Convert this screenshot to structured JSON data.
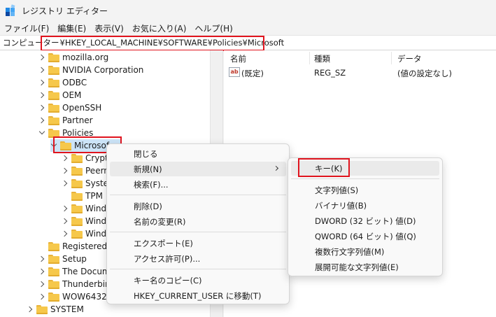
{
  "window": {
    "title": "レジストリ エディター",
    "app_icon": "registry-icon"
  },
  "menubar": {
    "items": [
      "ファイル(F)",
      "編集(E)",
      "表示(V)",
      "お気に入り(A)",
      "ヘルプ(H)"
    ]
  },
  "address": {
    "label": "コンピューター",
    "path": "¥HKEY_LOCAL_MACHINE¥SOFTWARE¥Policies¥Microsoft"
  },
  "tree": {
    "items": [
      {
        "label": "mozilla.org"
      },
      {
        "label": "NVIDIA Corporation"
      },
      {
        "label": "ODBC"
      },
      {
        "label": "OEM"
      },
      {
        "label": "OpenSSH"
      },
      {
        "label": "Partner"
      },
      {
        "label": "Policies"
      },
      {
        "label": "Microsof"
      },
      {
        "label": "Crypt"
      },
      {
        "label": "Peern"
      },
      {
        "label": "Syster"
      },
      {
        "label": "TPM"
      },
      {
        "label": "Windo"
      },
      {
        "label": "Windo"
      },
      {
        "label": "Windo"
      },
      {
        "label": "RegisteredA"
      },
      {
        "label": "Setup"
      },
      {
        "label": "The Docum"
      },
      {
        "label": "Thunderbir"
      },
      {
        "label": "WOW6432N"
      },
      {
        "label": "SYSTEM"
      }
    ]
  },
  "list": {
    "columns": [
      "名前",
      "種類",
      "データ"
    ],
    "rows": [
      {
        "name": "(既定)",
        "type": "REG_SZ",
        "data": "(値の設定なし)",
        "icon": "ab-string-icon"
      }
    ]
  },
  "context_menu": {
    "items": [
      "閉じる",
      "新規(N)",
      "検索(F)...",
      "削除(D)",
      "名前の変更(R)",
      "エクスポート(E)",
      "アクセス許可(P)...",
      "キー名のコピー(C)",
      "HKEY_CURRENT_USER に移動(T)"
    ]
  },
  "submenu": {
    "items": [
      "キー(K)",
      "文字列値(S)",
      "バイナリ値(B)",
      "DWORD (32 ビット) 値(D)",
      "QWORD (64 ビット) 値(Q)",
      "複数行文字列値(M)",
      "展開可能な文字列値(E)"
    ]
  },
  "colors": {
    "highlight_box": "#e0141e",
    "selection": "#cce4f7"
  }
}
